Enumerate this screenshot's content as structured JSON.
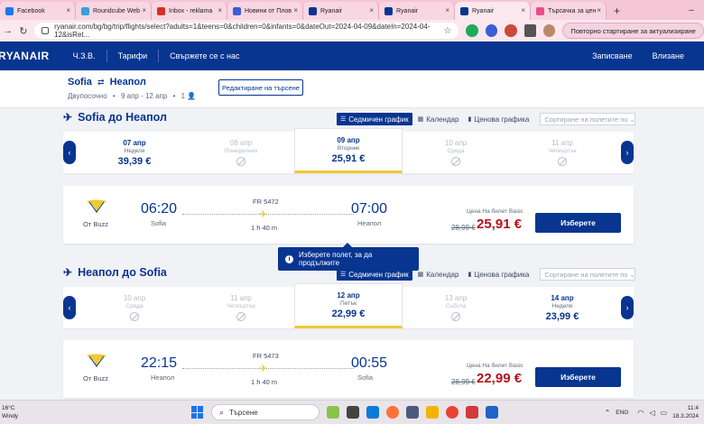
{
  "browser": {
    "tabs": [
      {
        "label": "Facebook",
        "color": "#1877f2"
      },
      {
        "label": "Roundcube Web",
        "color": "#37a1d9"
      },
      {
        "label": "Inbox - reklama",
        "color": "#d93025"
      },
      {
        "label": "Новини от Плов",
        "color": "#3b5dd6"
      },
      {
        "label": "Ryanair",
        "color": "#073590"
      },
      {
        "label": "Ryanair",
        "color": "#073590"
      },
      {
        "label": "Ryanair",
        "color": "#073590"
      },
      {
        "label": "Търсачка за цен",
        "color": "#e84f8a"
      }
    ],
    "url": "ryanair.com/bg/bg/trip/flights/select?adults=1&teens=0&children=0&infants=0&dateOut=2024-04-09&dateIn=2024-04-12&isRet...",
    "restart_label": "Повторно стартиране за актуализиране"
  },
  "nav": {
    "logo": "RYANAIR",
    "faq": "Ч.З.В.",
    "fares": "Тарифи",
    "contact": "Свържете се с нас",
    "signup": "Записване",
    "login": "Влизане"
  },
  "trip": {
    "from": "Sofia",
    "to": "Неапол",
    "type": "Двупосочно",
    "dates": "9 апр - 12 апр",
    "pax": "1",
    "edit_label": "Редактиране на търсене"
  },
  "view_tabs": {
    "weekly": "Седмичен график",
    "calendar": "Календар",
    "price": "Ценова графика",
    "sort_placeholder": "Сортиране на полетите по"
  },
  "outbound": {
    "title": "Sofia до Неапол",
    "dates": [
      {
        "date": "07 апр",
        "day": "Неделя",
        "price": "39,39 €",
        "available": true,
        "selected": false
      },
      {
        "date": "08 апр",
        "day": "Понеделник",
        "price": "",
        "available": false,
        "selected": false
      },
      {
        "date": "09 апр",
        "day": "Вторник",
        "price": "25,91 €",
        "available": true,
        "selected": true
      },
      {
        "date": "10 апр",
        "day": "Сряда",
        "price": "",
        "available": false,
        "selected": false
      },
      {
        "date": "11 апр",
        "day": "Четвъртък",
        "price": "",
        "available": false,
        "selected": false
      }
    ],
    "flight": {
      "operator": "От Buzz",
      "dep_time": "06:20",
      "dep_city": "Sofia",
      "flight_no": "FR 5472",
      "duration": "1 h 40 m",
      "arr_time": "07:00",
      "arr_city": "Неапол",
      "fare_label": "Цена На билет Basic",
      "old_price": "28,99 €",
      "price": "25,91 €",
      "select_label": "Изберете"
    }
  },
  "tooltip": "Изберете полет, за да продължите",
  "inbound": {
    "title": "Неапол до Sofia",
    "dates": [
      {
        "date": "10 апр",
        "day": "Сряда",
        "price": "",
        "available": false,
        "selected": false
      },
      {
        "date": "11 апр",
        "day": "Четвъртък",
        "price": "",
        "available": false,
        "selected": false
      },
      {
        "date": "12 апр",
        "day": "Петък",
        "price": "22,99 €",
        "available": true,
        "selected": true
      },
      {
        "date": "13 апр",
        "day": "Събота",
        "price": "",
        "available": false,
        "selected": false
      },
      {
        "date": "14 апр",
        "day": "Неделя",
        "price": "23,99 €",
        "available": true,
        "selected": false
      }
    ],
    "flight": {
      "operator": "От Buzz",
      "dep_time": "22:15",
      "dep_city": "Неапол",
      "flight_no": "FR 5473",
      "duration": "1 h 40 m",
      "arr_time": "00:55",
      "arr_city": "Sofia",
      "fare_label": "Цена На билет Basic",
      "old_price": "28,99 €",
      "price": "22,99 €",
      "select_label": "Изберете"
    }
  },
  "taskbar": {
    "temp": "16°C",
    "weather": "Windy",
    "search": "Търсене",
    "lang": "ENG",
    "time": "11:4",
    "date": "18.3.2024"
  }
}
